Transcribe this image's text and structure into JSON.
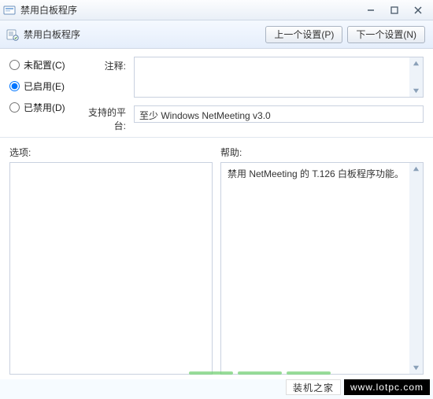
{
  "window": {
    "title": "禁用白板程序"
  },
  "toolbar": {
    "title": "禁用白板程序"
  },
  "nav": {
    "prev": "上一个设置(P)",
    "next": "下一个设置(N)"
  },
  "config": {
    "radio_notconfigured": "未配置(C)",
    "radio_enabled": "已启用(E)",
    "radio_disabled": "已禁用(D)",
    "selected": "enabled",
    "annotation_label": "注释:",
    "annotation_value": "",
    "platform_label": "支持的平台:",
    "platform_value": "至少 Windows NetMeeting v3.0"
  },
  "sections": {
    "options_label": "选项:",
    "help_label": "帮助:",
    "options_content": "",
    "help_content": "禁用 NetMeeting 的 T.126 白板程序功能。"
  },
  "footer": {
    "brand_cn": "装机之家",
    "brand_url": "www.lotpc.com"
  }
}
